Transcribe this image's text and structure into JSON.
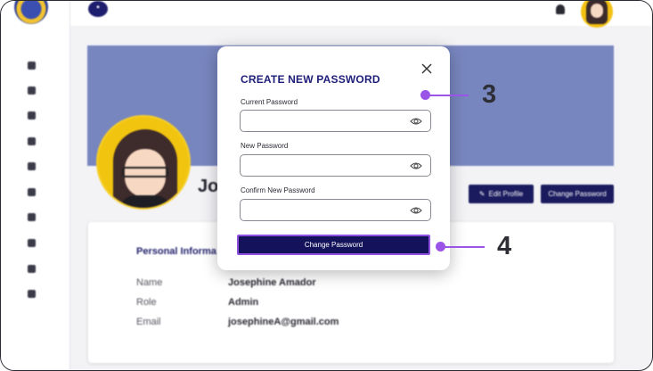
{
  "header": {
    "menu_icon": "grid-icon",
    "notification_icon": "bell-icon"
  },
  "sidebar": {
    "logo": "school-seal-logo",
    "items": [
      {
        "icon": "dashboard-icon"
      },
      {
        "icon": "network-icon"
      },
      {
        "icon": "user-icon"
      },
      {
        "icon": "folder-icon"
      },
      {
        "icon": "bug-icon"
      },
      {
        "icon": "book-icon"
      },
      {
        "icon": "calendar-icon"
      },
      {
        "icon": "layers-icon"
      },
      {
        "icon": "list-icon"
      },
      {
        "icon": "logout-icon"
      }
    ]
  },
  "profile": {
    "name_partial": "Jos",
    "edit_profile_label": "Edit Profile",
    "change_password_label": "Change Password"
  },
  "info_card": {
    "title_partial": "Personal Informa",
    "rows": [
      {
        "label": "Name",
        "value": "Josephine Amador"
      },
      {
        "label": "Role",
        "value": "Admin"
      },
      {
        "label": "Email",
        "value": "josephineA@gmail.com"
      }
    ]
  },
  "modal": {
    "title": "CREATE NEW PASSWORD",
    "fields": [
      {
        "label": "Current Password",
        "value": "",
        "placeholder": ""
      },
      {
        "label": "New Password",
        "value": "",
        "placeholder": ""
      },
      {
        "label": "Confirm New Password",
        "value": "",
        "placeholder": ""
      }
    ],
    "submit_label": "Change Password"
  },
  "callouts": {
    "first": "3",
    "second": "4"
  },
  "colors": {
    "primary": "#13125a",
    "title": "#1e1e7a",
    "banner": "#7886bf",
    "callout": "#9a55e8",
    "avatar_bg": "#f1c40f"
  }
}
